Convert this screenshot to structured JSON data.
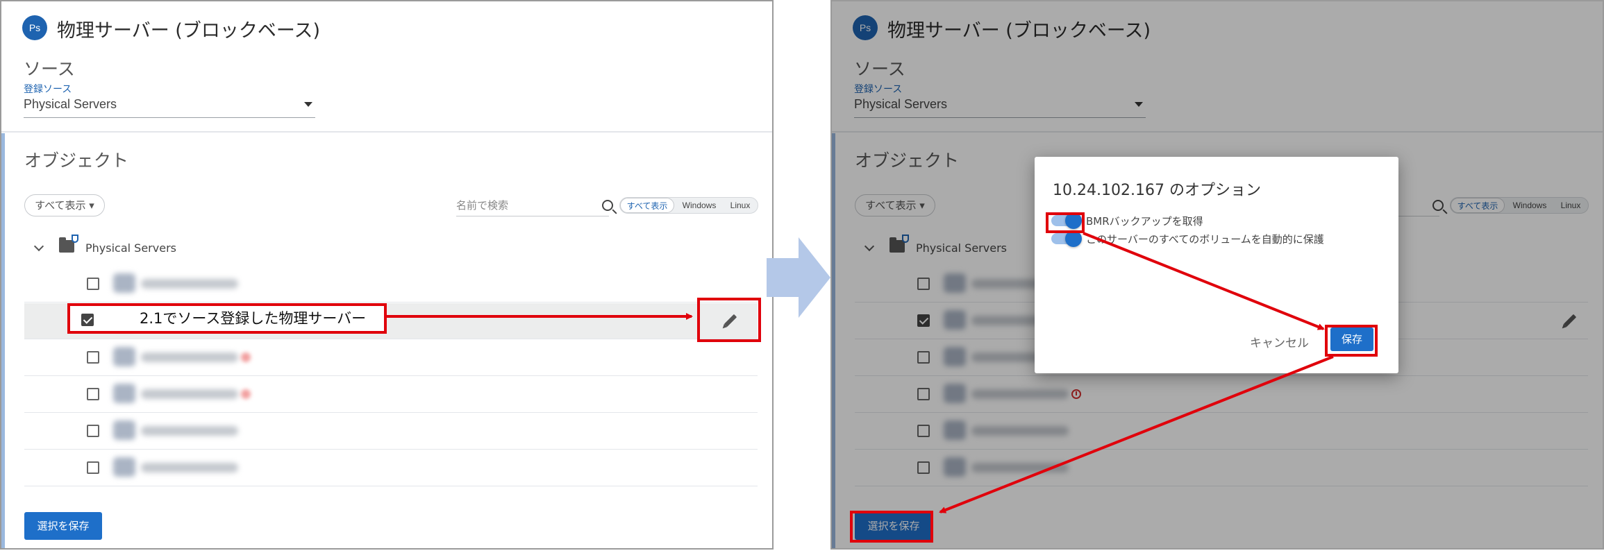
{
  "colors": {
    "accent": "#1e6fc9",
    "annotation": "#e0000b",
    "flow_arrow": "#b4c8e8"
  },
  "header": {
    "badge": "Ps",
    "title": "物理サーバー (ブロックベース)",
    "source_heading": "ソース",
    "source_label": "登録ソース",
    "source_value": "Physical Servers"
  },
  "objects": {
    "heading": "オブジェクト",
    "filter_label": "すべて表示",
    "search_placeholder": "名前で検索",
    "segments": [
      "すべて表示",
      "Windows",
      "Linux"
    ],
    "tree_root": "Physical Servers"
  },
  "save_selection": "選択を保存",
  "annotation_text": "2.1でソース登録した物理サーバー",
  "dialog": {
    "title": "10.24.102.167 のオプション",
    "options": [
      "BMRバックアップを取得",
      "このサーバーのすべてのボリュームを自動的に保護"
    ],
    "cancel": "キャンセル",
    "save": "保存"
  }
}
